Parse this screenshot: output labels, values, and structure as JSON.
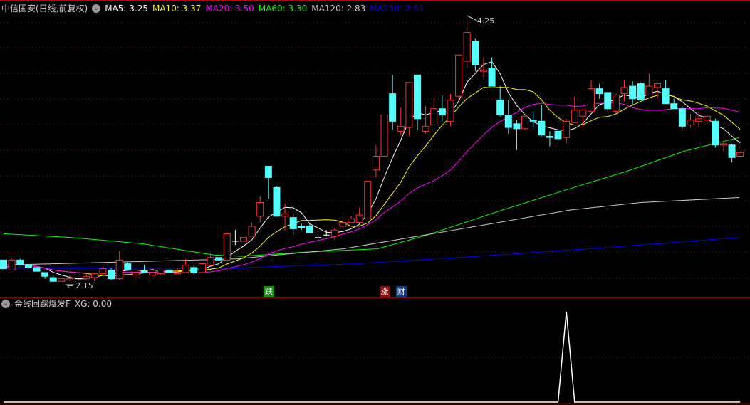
{
  "header": {
    "title": "中信国安(日线,前复权)",
    "ma_labels": [
      {
        "label": "MA5: 3.25",
        "color": "#ffffff"
      },
      {
        "label": "MA10: 3.37",
        "color": "#ffff00"
      },
      {
        "label": "MA20: 3.50",
        "color": "#ff00ff"
      },
      {
        "label": "MA60: 3.30",
        "color": "#00ff00"
      },
      {
        "label": "MA120: 2.83",
        "color": "#c8c8c8"
      },
      {
        "label": "MA250: 2.51",
        "color": "#0000ff"
      }
    ],
    "menu_icon": "chevron-down-circle-icon"
  },
  "indicator": {
    "title": "金线回踩爆发F",
    "value_label": "XG: 0.00",
    "menu_icon": "chevron-down-circle-icon"
  },
  "markers": [
    {
      "text": "跌",
      "index": 32,
      "bg": "#1a8a1a"
    },
    {
      "text": "涨",
      "index": 46,
      "bg": "#8a1010"
    },
    {
      "text": "财",
      "index": 48,
      "bg": "#103a7a"
    }
  ],
  "chart_data": {
    "type": "candlestick",
    "colors": {
      "up": "#ff3232",
      "down": "#54ffff",
      "doji": "#ffffff",
      "grid": "#8a1a1a",
      "border": "#c00000"
    },
    "price_annotations": {
      "high": "4.25",
      "low": "2.15"
    },
    "ylim": [
      2.15,
      4.25
    ],
    "candles_ohlc": [
      [
        2.33,
        2.33,
        2.26,
        2.26
      ],
      [
        2.25,
        2.34,
        2.25,
        2.33
      ],
      [
        2.33,
        2.34,
        2.29,
        2.29
      ],
      [
        2.29,
        2.29,
        2.26,
        2.27
      ],
      [
        2.27,
        2.27,
        2.24,
        2.24
      ],
      [
        2.23,
        2.23,
        2.18,
        2.2
      ],
      [
        2.19,
        2.21,
        2.16,
        2.16
      ],
      [
        2.16,
        2.18,
        2.16,
        2.18
      ],
      [
        2.17,
        2.21,
        2.16,
        2.18
      ],
      [
        2.18,
        2.2,
        2.15,
        2.18
      ],
      [
        2.18,
        2.22,
        2.18,
        2.2
      ],
      [
        2.19,
        2.22,
        2.16,
        2.22
      ],
      [
        2.22,
        2.28,
        2.22,
        2.26
      ],
      [
        2.25,
        2.27,
        2.17,
        2.18
      ],
      [
        2.18,
        2.4,
        2.17,
        2.33
      ],
      [
        2.3,
        2.31,
        2.25,
        2.25
      ],
      [
        2.21,
        2.23,
        2.21,
        2.23
      ],
      [
        2.24,
        2.29,
        2.23,
        2.23
      ],
      [
        2.21,
        2.23,
        2.21,
        2.23
      ],
      [
        2.22,
        2.25,
        2.21,
        2.25
      ],
      [
        2.25,
        2.25,
        2.23,
        2.23
      ],
      [
        2.22,
        2.27,
        2.22,
        2.23
      ],
      [
        2.23,
        2.34,
        2.23,
        2.29
      ],
      [
        2.27,
        2.29,
        2.21,
        2.23
      ],
      [
        2.23,
        2.3,
        2.23,
        2.3
      ],
      [
        2.29,
        2.38,
        2.29,
        2.35
      ],
      [
        2.35,
        2.35,
        2.33,
        2.33
      ],
      [
        2.33,
        2.55,
        2.33,
        2.54
      ],
      [
        2.48,
        2.57,
        2.45,
        2.48
      ],
      [
        2.48,
        2.51,
        2.48,
        2.51
      ],
      [
        2.52,
        2.63,
        2.52,
        2.6
      ],
      [
        2.68,
        2.84,
        2.63,
        2.79
      ],
      [
        3.08,
        3.08,
        2.82,
        2.99
      ],
      [
        2.91,
        2.92,
        2.68,
        2.68
      ],
      [
        2.68,
        2.78,
        2.57,
        2.7
      ],
      [
        2.67,
        2.7,
        2.53,
        2.58
      ],
      [
        2.6,
        2.62,
        2.57,
        2.59
      ],
      [
        2.6,
        2.62,
        2.55,
        2.55
      ],
      [
        2.51,
        2.56,
        2.49,
        2.51
      ],
      [
        2.53,
        2.57,
        2.52,
        2.53
      ],
      [
        2.52,
        2.59,
        2.49,
        2.57
      ],
      [
        2.6,
        2.71,
        2.58,
        2.63
      ],
      [
        2.63,
        2.68,
        2.63,
        2.66
      ],
      [
        2.63,
        2.75,
        2.63,
        2.69
      ],
      [
        2.66,
        2.96,
        2.66,
        2.96
      ],
      [
        3.05,
        3.25,
        2.99,
        3.16
      ],
      [
        3.16,
        3.49,
        3.16,
        3.49
      ],
      [
        3.66,
        3.81,
        3.37,
        3.44
      ],
      [
        3.36,
        3.55,
        3.33,
        3.4
      ],
      [
        3.39,
        3.75,
        3.32,
        3.75
      ],
      [
        3.81,
        3.81,
        3.37,
        3.46
      ],
      [
        3.36,
        3.56,
        3.34,
        3.4
      ],
      [
        3.41,
        3.62,
        3.41,
        3.54
      ],
      [
        3.54,
        3.65,
        3.44,
        3.49
      ],
      [
        3.44,
        3.66,
        3.4,
        3.61
      ],
      [
        3.64,
        3.97,
        3.61,
        3.97
      ],
      [
        3.92,
        4.25,
        3.87,
        4.15
      ],
      [
        4.08,
        4.1,
        3.84,
        3.89
      ],
      [
        3.84,
        3.95,
        3.79,
        3.85
      ],
      [
        3.86,
        3.95,
        3.72,
        3.72
      ],
      [
        3.61,
        3.72,
        3.48,
        3.49
      ],
      [
        3.49,
        3.61,
        3.34,
        3.39
      ],
      [
        3.42,
        3.45,
        3.21,
        3.38
      ],
      [
        3.38,
        3.48,
        3.37,
        3.48
      ],
      [
        3.45,
        3.52,
        3.39,
        3.44
      ],
      [
        3.44,
        3.57,
        3.32,
        3.33
      ],
      [
        3.32,
        3.36,
        3.24,
        3.31
      ],
      [
        3.36,
        3.45,
        3.3,
        3.3
      ],
      [
        3.31,
        3.46,
        3.26,
        3.44
      ],
      [
        3.43,
        3.64,
        3.43,
        3.53
      ],
      [
        3.48,
        3.54,
        3.39,
        3.53
      ],
      [
        3.52,
        3.77,
        3.52,
        3.7
      ],
      [
        3.7,
        3.74,
        3.62,
        3.66
      ],
      [
        3.67,
        3.67,
        3.52,
        3.54
      ],
      [
        3.52,
        3.66,
        3.5,
        3.65
      ],
      [
        3.66,
        3.77,
        3.6,
        3.71
      ],
      [
        3.72,
        3.76,
        3.57,
        3.62
      ],
      [
        3.74,
        3.75,
        3.61,
        3.61
      ],
      [
        3.65,
        3.82,
        3.65,
        3.72
      ],
      [
        3.71,
        3.74,
        3.62,
        3.74
      ],
      [
        3.7,
        3.77,
        3.58,
        3.58
      ],
      [
        3.58,
        3.62,
        3.54,
        3.54
      ],
      [
        3.54,
        3.56,
        3.38,
        3.4
      ],
      [
        3.41,
        3.5,
        3.39,
        3.45
      ],
      [
        3.44,
        3.52,
        3.39,
        3.46
      ],
      [
        3.45,
        3.48,
        3.44,
        3.48
      ],
      [
        3.44,
        3.46,
        3.23,
        3.25
      ],
      [
        3.25,
        3.28,
        3.2,
        3.26
      ],
      [
        3.25,
        3.26,
        3.11,
        3.15
      ],
      [
        3.16,
        3.2,
        3.16,
        3.19
      ]
    ],
    "ma_computed": [
      {
        "name": "MA5",
        "period": 5,
        "color": "#ffffff"
      },
      {
        "name": "MA10",
        "period": 10,
        "color": "#ffff00"
      },
      {
        "name": "MA20",
        "period": 20,
        "color": "#ff00ff"
      }
    ],
    "ma_sampled": [
      {
        "name": "MA60",
        "color": "#00ff00",
        "points": [
          [
            0,
            2.54
          ],
          [
            8.2,
            2.51
          ],
          [
            16.8,
            2.46
          ],
          [
            25.4,
            2.37
          ],
          [
            28.8,
            2.36
          ],
          [
            35.7,
            2.39
          ],
          [
            45.2,
            2.42
          ],
          [
            51.2,
            2.53
          ],
          [
            59.8,
            2.72
          ],
          [
            68.4,
            2.9
          ],
          [
            75.3,
            3.04
          ],
          [
            82.2,
            3.2
          ],
          [
            88.9,
            3.31
          ]
        ]
      },
      {
        "name": "MA120",
        "color": "#c8c8c8",
        "points": [
          [
            0,
            2.29
          ],
          [
            17.5,
            2.32
          ],
          [
            28.2,
            2.34
          ],
          [
            41.1,
            2.42
          ],
          [
            59.8,
            2.63
          ],
          [
            68.4,
            2.73
          ],
          [
            77.0,
            2.79
          ],
          [
            88.9,
            2.83
          ]
        ]
      },
      {
        "name": "MA250",
        "color": "#0000ff",
        "points": [
          [
            0,
            2.27
          ],
          [
            25.4,
            2.26
          ],
          [
            42.6,
            2.3
          ],
          [
            59.8,
            2.37
          ],
          [
            77.0,
            2.45
          ],
          [
            88.9,
            2.51
          ]
        ]
      }
    ],
    "indicator_series": {
      "name": "XG",
      "ylim": [
        0,
        1
      ],
      "nonzero": [
        [
          68,
          1
        ]
      ],
      "color": "#ffffff"
    }
  }
}
